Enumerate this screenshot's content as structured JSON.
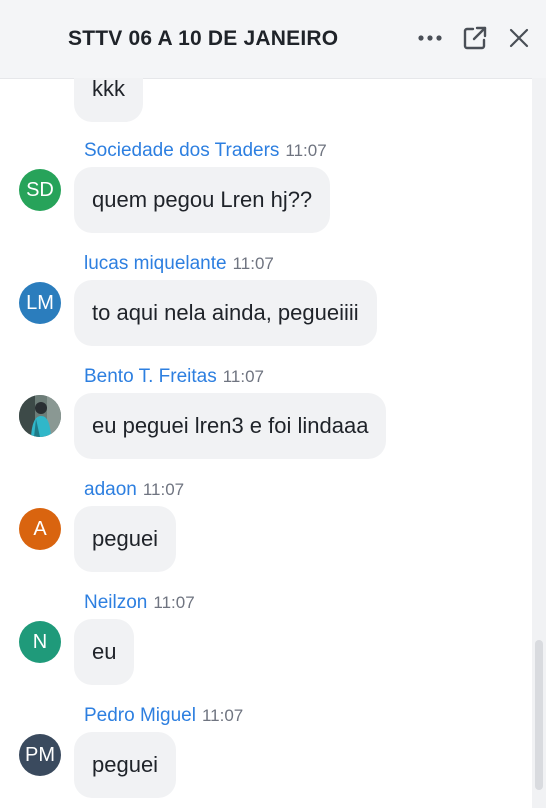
{
  "header": {
    "title": "STTV 06 A 10 DE JANEIRO",
    "more_icon": "more-horizontal-icon",
    "popout_icon": "pop-out-icon",
    "close_icon": "close-icon"
  },
  "messages": [
    {
      "text": "kkk"
    },
    {
      "sender": "Sociedade dos Traders",
      "time": "11:07",
      "initials": "SD",
      "avatar_color": "#27a35a",
      "text": "quem pegou Lren hj??"
    },
    {
      "sender": "lucas miquelante",
      "time": "11:07",
      "initials": "LM",
      "avatar_color": "#2b7dbd",
      "text": "to aqui nela ainda, pegueiiii"
    },
    {
      "sender": "Bento T. Freitas",
      "time": "11:07",
      "avatar_type": "photo",
      "text": "eu peguei lren3 e foi lindaaa"
    },
    {
      "sender": "adaon",
      "time": "11:07",
      "initials": "A",
      "avatar_color": "#d9640f",
      "text": "peguei"
    },
    {
      "sender": "Neilzon",
      "time": "11:07",
      "initials": "N",
      "avatar_color": "#1f9a7a",
      "text": "eu"
    },
    {
      "sender": "Pedro Miguel",
      "time": "11:07",
      "initials": "PM",
      "avatar_color": "#3a4a5e",
      "text": "peguei"
    }
  ]
}
